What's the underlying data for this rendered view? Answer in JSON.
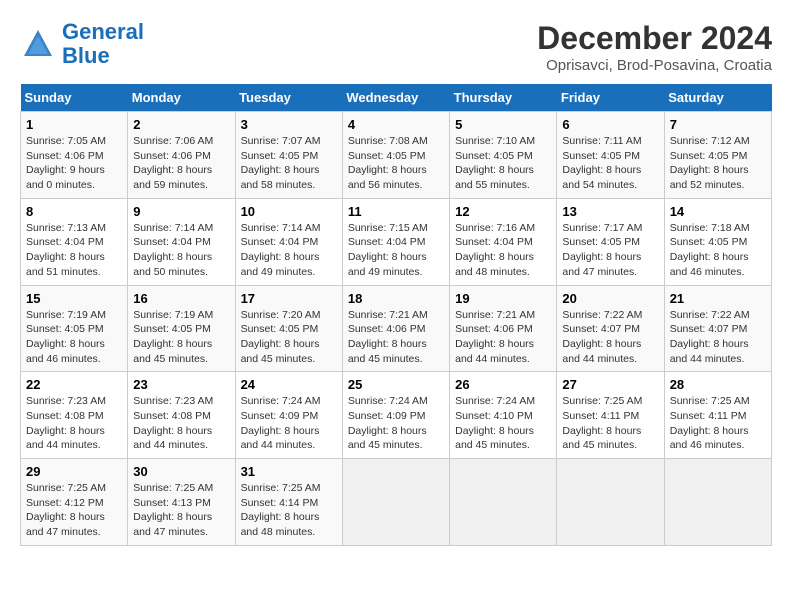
{
  "logo": {
    "line1": "General",
    "line2": "Blue"
  },
  "title": "December 2024",
  "subtitle": "Oprisavci, Brod-Posavina, Croatia",
  "days_of_week": [
    "Sunday",
    "Monday",
    "Tuesday",
    "Wednesday",
    "Thursday",
    "Friday",
    "Saturday"
  ],
  "weeks": [
    [
      {
        "day": "1",
        "detail": "Sunrise: 7:05 AM\nSunset: 4:06 PM\nDaylight: 9 hours\nand 0 minutes."
      },
      {
        "day": "2",
        "detail": "Sunrise: 7:06 AM\nSunset: 4:06 PM\nDaylight: 8 hours\nand 59 minutes."
      },
      {
        "day": "3",
        "detail": "Sunrise: 7:07 AM\nSunset: 4:05 PM\nDaylight: 8 hours\nand 58 minutes."
      },
      {
        "day": "4",
        "detail": "Sunrise: 7:08 AM\nSunset: 4:05 PM\nDaylight: 8 hours\nand 56 minutes."
      },
      {
        "day": "5",
        "detail": "Sunrise: 7:10 AM\nSunset: 4:05 PM\nDaylight: 8 hours\nand 55 minutes."
      },
      {
        "day": "6",
        "detail": "Sunrise: 7:11 AM\nSunset: 4:05 PM\nDaylight: 8 hours\nand 54 minutes."
      },
      {
        "day": "7",
        "detail": "Sunrise: 7:12 AM\nSunset: 4:05 PM\nDaylight: 8 hours\nand 52 minutes."
      }
    ],
    [
      {
        "day": "8",
        "detail": "Sunrise: 7:13 AM\nSunset: 4:04 PM\nDaylight: 8 hours\nand 51 minutes."
      },
      {
        "day": "9",
        "detail": "Sunrise: 7:14 AM\nSunset: 4:04 PM\nDaylight: 8 hours\nand 50 minutes."
      },
      {
        "day": "10",
        "detail": "Sunrise: 7:14 AM\nSunset: 4:04 PM\nDaylight: 8 hours\nand 49 minutes."
      },
      {
        "day": "11",
        "detail": "Sunrise: 7:15 AM\nSunset: 4:04 PM\nDaylight: 8 hours\nand 49 minutes."
      },
      {
        "day": "12",
        "detail": "Sunrise: 7:16 AM\nSunset: 4:04 PM\nDaylight: 8 hours\nand 48 minutes."
      },
      {
        "day": "13",
        "detail": "Sunrise: 7:17 AM\nSunset: 4:05 PM\nDaylight: 8 hours\nand 47 minutes."
      },
      {
        "day": "14",
        "detail": "Sunrise: 7:18 AM\nSunset: 4:05 PM\nDaylight: 8 hours\nand 46 minutes."
      }
    ],
    [
      {
        "day": "15",
        "detail": "Sunrise: 7:19 AM\nSunset: 4:05 PM\nDaylight: 8 hours\nand 46 minutes."
      },
      {
        "day": "16",
        "detail": "Sunrise: 7:19 AM\nSunset: 4:05 PM\nDaylight: 8 hours\nand 45 minutes."
      },
      {
        "day": "17",
        "detail": "Sunrise: 7:20 AM\nSunset: 4:05 PM\nDaylight: 8 hours\nand 45 minutes."
      },
      {
        "day": "18",
        "detail": "Sunrise: 7:21 AM\nSunset: 4:06 PM\nDaylight: 8 hours\nand 45 minutes."
      },
      {
        "day": "19",
        "detail": "Sunrise: 7:21 AM\nSunset: 4:06 PM\nDaylight: 8 hours\nand 44 minutes."
      },
      {
        "day": "20",
        "detail": "Sunrise: 7:22 AM\nSunset: 4:07 PM\nDaylight: 8 hours\nand 44 minutes."
      },
      {
        "day": "21",
        "detail": "Sunrise: 7:22 AM\nSunset: 4:07 PM\nDaylight: 8 hours\nand 44 minutes."
      }
    ],
    [
      {
        "day": "22",
        "detail": "Sunrise: 7:23 AM\nSunset: 4:08 PM\nDaylight: 8 hours\nand 44 minutes."
      },
      {
        "day": "23",
        "detail": "Sunrise: 7:23 AM\nSunset: 4:08 PM\nDaylight: 8 hours\nand 44 minutes."
      },
      {
        "day": "24",
        "detail": "Sunrise: 7:24 AM\nSunset: 4:09 PM\nDaylight: 8 hours\nand 44 minutes."
      },
      {
        "day": "25",
        "detail": "Sunrise: 7:24 AM\nSunset: 4:09 PM\nDaylight: 8 hours\nand 45 minutes."
      },
      {
        "day": "26",
        "detail": "Sunrise: 7:24 AM\nSunset: 4:10 PM\nDaylight: 8 hours\nand 45 minutes."
      },
      {
        "day": "27",
        "detail": "Sunrise: 7:25 AM\nSunset: 4:11 PM\nDaylight: 8 hours\nand 45 minutes."
      },
      {
        "day": "28",
        "detail": "Sunrise: 7:25 AM\nSunset: 4:11 PM\nDaylight: 8 hours\nand 46 minutes."
      }
    ],
    [
      {
        "day": "29",
        "detail": "Sunrise: 7:25 AM\nSunset: 4:12 PM\nDaylight: 8 hours\nand 47 minutes."
      },
      {
        "day": "30",
        "detail": "Sunrise: 7:25 AM\nSunset: 4:13 PM\nDaylight: 8 hours\nand 47 minutes."
      },
      {
        "day": "31",
        "detail": "Sunrise: 7:25 AM\nSunset: 4:14 PM\nDaylight: 8 hours\nand 48 minutes."
      },
      null,
      null,
      null,
      null
    ]
  ]
}
